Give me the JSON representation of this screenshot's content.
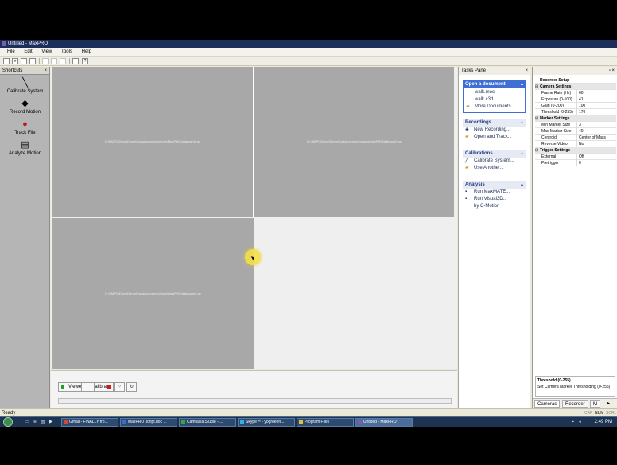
{
  "window": {
    "title": "Untitled - MaxPRO"
  },
  "menu": [
    "File",
    "Edit",
    "View",
    "Tools",
    "Help"
  ],
  "shortcuts": {
    "header": "Shortcuts",
    "items": [
      "Calibrate System",
      "Record Motion",
      "Track File",
      "Analyze Motion"
    ]
  },
  "views": [
    "H:\\SMPC\\Docs\\Demo\\Sudas\\xxxxxxx\\ptions\\MaxPRO\\data\\cam1.ax",
    "H:\\SMPC\\Docs\\Demo\\Sudas\\xxxxxxx\\ptions\\MaxPRO\\dat\\cam2.ax",
    "H:\\SMPC\\Docs\\Demo\\Sudas\\xxxxxxx\\ptions\\MaxPRO\\data\\cam3.ax"
  ],
  "controls": {
    "viewer": "Viewer",
    "calibrate": "Calibrate"
  },
  "tasks": {
    "header": "Tasks Pane",
    "sections": [
      {
        "title": "Open a document",
        "links": [
          "walk.moc",
          "walk.c3d",
          "More Documents..."
        ]
      },
      {
        "title": "Recordings",
        "links": [
          "New Recording...",
          "Open and Track..."
        ]
      },
      {
        "title": "Calibrations",
        "links": [
          "Calibrate System...",
          "Use Another..."
        ]
      },
      {
        "title": "Analysis",
        "links": [
          "Run MaxMATE...",
          "Run Visual3D...",
          "by C-Motion"
        ]
      }
    ]
  },
  "recorder": {
    "heading": "Recorder Setup",
    "groups": [
      {
        "name": "Camera Settings",
        "rows": [
          {
            "label": "Frame Rate (Hz)",
            "value": "60"
          },
          {
            "label": "Exposure (0-100)",
            "value": "41"
          },
          {
            "label": "Gain (0-200)",
            "value": "100"
          },
          {
            "label": "Threshold (0-255)",
            "value": "170"
          }
        ]
      },
      {
        "name": "Marker Settings",
        "rows": [
          {
            "label": "Min Marker Size",
            "value": "3"
          },
          {
            "label": "Max Marker Size",
            "value": "40"
          },
          {
            "label": "Centroid",
            "value": "Center of Mass"
          },
          {
            "label": "Reverse Video",
            "value": "No"
          }
        ]
      },
      {
        "name": "Trigger Settings",
        "rows": [
          {
            "label": "External",
            "value": "Off"
          },
          {
            "label": "Pretrigger",
            "value": "0"
          }
        ]
      }
    ],
    "desc_title": "Threshold (0-255)",
    "desc_text": "Set Camera Marker Thresholding (0-255)",
    "tabs": [
      "Cameras",
      "Recorder",
      "M"
    ]
  },
  "status": {
    "left": "Ready",
    "cap": "CAP",
    "num": "NUM",
    "scrl": "SCRL"
  },
  "taskbar": {
    "buttons": [
      "Gmail - FINALLY fro...",
      "MaxPRO script.doc ...",
      "Camtasia Studio - ...",
      "Skype™ - yogreeen...",
      "Program Files",
      "Untitled - MaxPRO"
    ],
    "clock": "2:49 PM"
  }
}
